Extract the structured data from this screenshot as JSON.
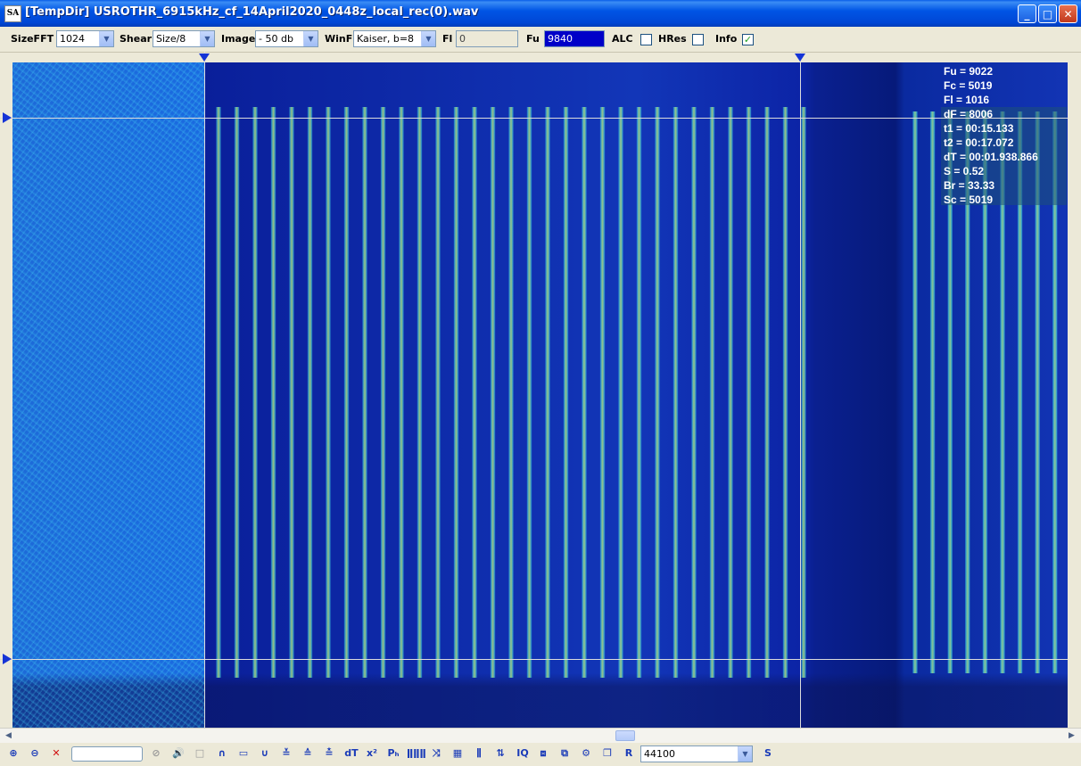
{
  "window": {
    "app_icon": "SA",
    "title": "[TempDir] USROTHR_6915kHz_cf_14April2020_0448z_local_rec(0).wav",
    "minimize": "_",
    "maximize": "□",
    "close": "✕"
  },
  "toolbar": {
    "sizefft_label": "SizeFFT",
    "sizefft_value": "1024",
    "shear_label": "Shear",
    "shear_value": "Size/8",
    "image_label": "Image",
    "image_value": "- 50 db",
    "winf_label": "WinF",
    "winf_value": "Kaiser, b=8",
    "fl_label": "Fl",
    "fl_value": "0",
    "fu_label": "Fu",
    "fu_value": "9840",
    "alc_label": "ALC",
    "alc_checked": false,
    "hres_label": "HRes",
    "hres_checked": false,
    "info_label": "Info",
    "info_checked": true,
    "check_mark": "✓"
  },
  "info_overlay": [
    "Fu = 9022",
    "Fc = 5019",
    "Fl = 1016",
    "dF = 8006",
    "t1 = 00:15.133",
    "t2 = 00:17.072",
    "dT = 00:01.938.866",
    "S = 0.52",
    "Br = 33.33",
    "Sc = 5019"
  ],
  "colors": {
    "spectrogram_base": "#1236b8",
    "signal_stripe": "#46e6e6",
    "cursor_marker": "#1433d6",
    "fu_field_bg": "#0000c8"
  },
  "scrollbar": {
    "left_arrow": "◀",
    "right_arrow": "▶"
  },
  "bottom_toolbar": {
    "icons": [
      "zoom-in-icon",
      "zoom-out-icon",
      "cancel-zoom-icon",
      "disabled-icon",
      "speaker-icon",
      "stop-icon",
      "arc-icon",
      "rectangle-icon",
      "valley-icon",
      "peak-up-icon",
      "peak-down-icon",
      "peak-both-icon",
      "dt-icon",
      "x-squared-icon",
      "ph-icon",
      "bars-icon",
      "cross-icon",
      "table-icon",
      "waveform-icon",
      "sort-icon",
      "iq-icon",
      "pattern-icon",
      "pattern2-icon",
      "gear-icon",
      "copy-icon",
      "r-icon",
      "s-icon"
    ],
    "glyphs": {
      "zoom_in": "⊕",
      "zoom_out": "⊖",
      "cancel_zoom": "✕",
      "disabled": "⊘",
      "speaker": "🔊",
      "stop": "□",
      "arc": "∩",
      "rect": "▭",
      "valley": "∪",
      "peak_up": "≚",
      "peak_down": "≙",
      "peak_both": "≛",
      "dt": "dT",
      "x2": "x²",
      "ph": "Pₕ",
      "bars": "ǁǁǁ",
      "cross": "⤨",
      "table": "▦",
      "wave": "⫼",
      "sort": "⇅",
      "iq": "IQ",
      "pat1": "⧈",
      "pat2": "⧉",
      "gear": "⚙",
      "copy": "❐",
      "r": "R",
      "s": "S"
    },
    "sample_rate": "44100"
  }
}
